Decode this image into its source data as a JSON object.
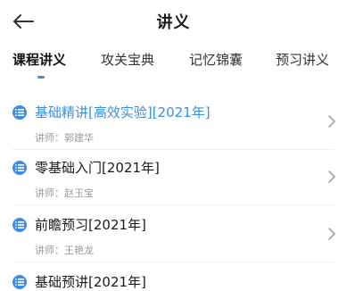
{
  "header": {
    "title": "讲义"
  },
  "tabs": [
    {
      "label": "课程讲义",
      "active": true
    },
    {
      "label": "攻关宝典",
      "active": false
    },
    {
      "label": "记忆锦囊",
      "active": false
    },
    {
      "label": "预习讲义",
      "active": false
    }
  ],
  "lectures": [
    {
      "title": "基础精讲[高效实验][2021年]",
      "teacher": "讲师：郭建华",
      "active": true
    },
    {
      "title": "零基础入门[2021年]",
      "teacher": "讲师：赵玉宝",
      "active": false
    },
    {
      "title": "前瞻预习[2021年]",
      "teacher": "讲师：王艳龙",
      "active": false
    },
    {
      "title": "基础预讲[2021年]",
      "teacher": "",
      "active": false
    }
  ],
  "colors": {
    "accent": "#3a8ee6",
    "text": "#1a1a1a",
    "subtext": "#999999"
  },
  "icons": {
    "back": "arrow-left-icon",
    "list": "list-icon",
    "chevron": "chevron-right-icon"
  }
}
